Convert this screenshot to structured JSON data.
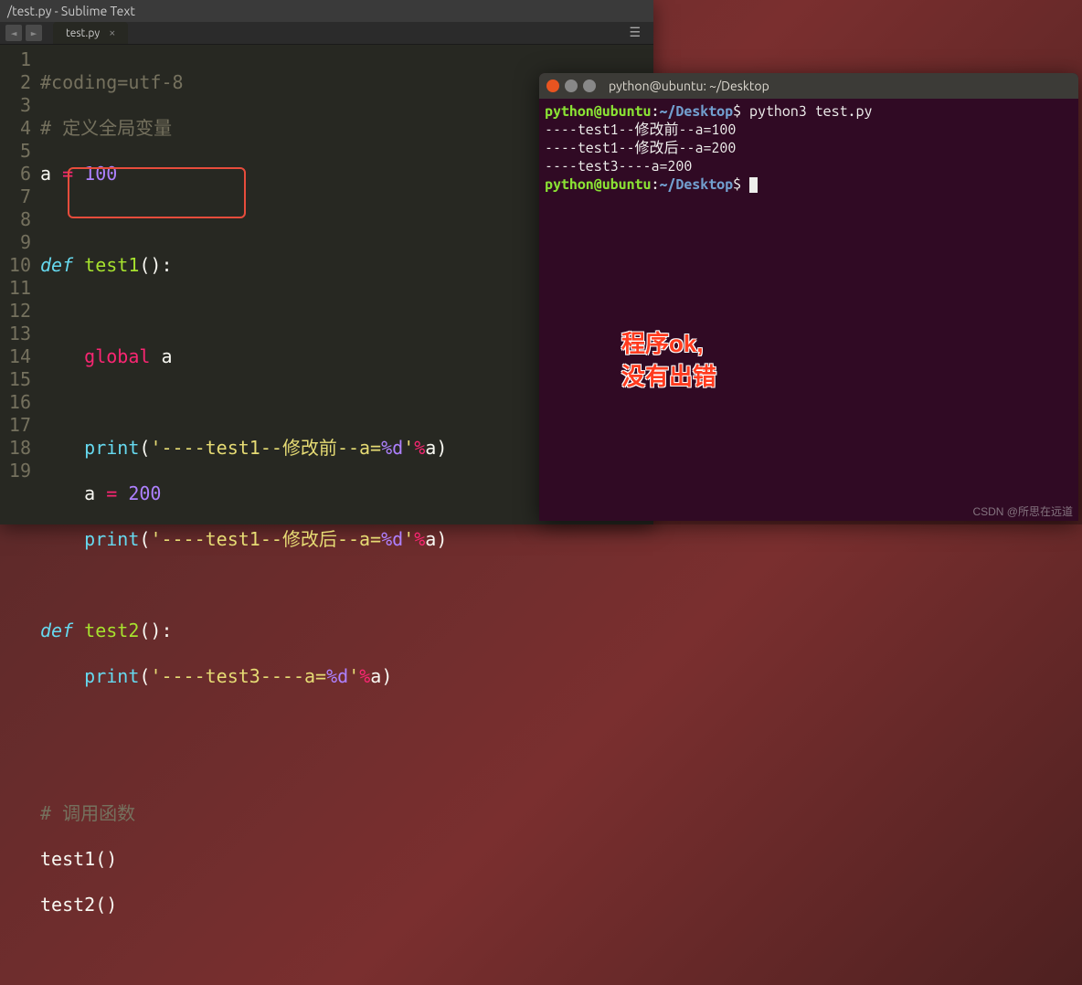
{
  "sublime": {
    "title": "/test.py - Sublime Text",
    "tab": "test.py",
    "tab_close": "×",
    "nav_left": "◄",
    "nav_right": "►",
    "hamburger": "☰",
    "lines": [
      "1",
      "2",
      "3",
      "4",
      "5",
      "6",
      "7",
      "8",
      "9",
      "10",
      "11",
      "12",
      "13",
      "14",
      "15",
      "16",
      "17",
      "18",
      "19"
    ],
    "code": {
      "l1": "#coding=utf-8",
      "l2_hash": "#",
      "l2_text": " 定义全局变量",
      "l3_var": "a",
      "l3_eq": " = ",
      "l3_val": "100",
      "l5_def": "def",
      "l5_name": " test1",
      "l5_paren": "():",
      "l7_global": "global",
      "l7_var": " a",
      "l9_print": "print",
      "l9_open": "(",
      "l9_str1": "'----test1--",
      "l9_str2": "修改前",
      "l9_str3": "--a=",
      "l9_fmt": "%d",
      "l9_str4": "'",
      "l9_pct": "%",
      "l9_arg": "a)",
      "l10_var": "a",
      "l10_eq": " = ",
      "l10_val": "200",
      "l11_print": "print",
      "l11_str2": "修改后",
      "l13_def": "def",
      "l13_name": " test2",
      "l14_print": "print",
      "l14_str": "'----test3----a=",
      "l17_hash": "#",
      "l17_text": " 调用函数",
      "l18": "test1()",
      "l19": "test2()"
    }
  },
  "terminal": {
    "title": "python@ubuntu: ~/Desktop",
    "prompt_user": "python@ubuntu",
    "prompt_colon": ":",
    "prompt_path": "~/Desktop",
    "prompt_dollar": "$",
    "cmd": " python3 test.py",
    "out1": "----test1--修改前--a=100",
    "out2": "----test1--修改后--a=200",
    "out3": "----test3----a=200",
    "annotation_l1": "程序ok,",
    "annotation_l2": "没有出错"
  },
  "watermark": "CSDN @所思在远道"
}
